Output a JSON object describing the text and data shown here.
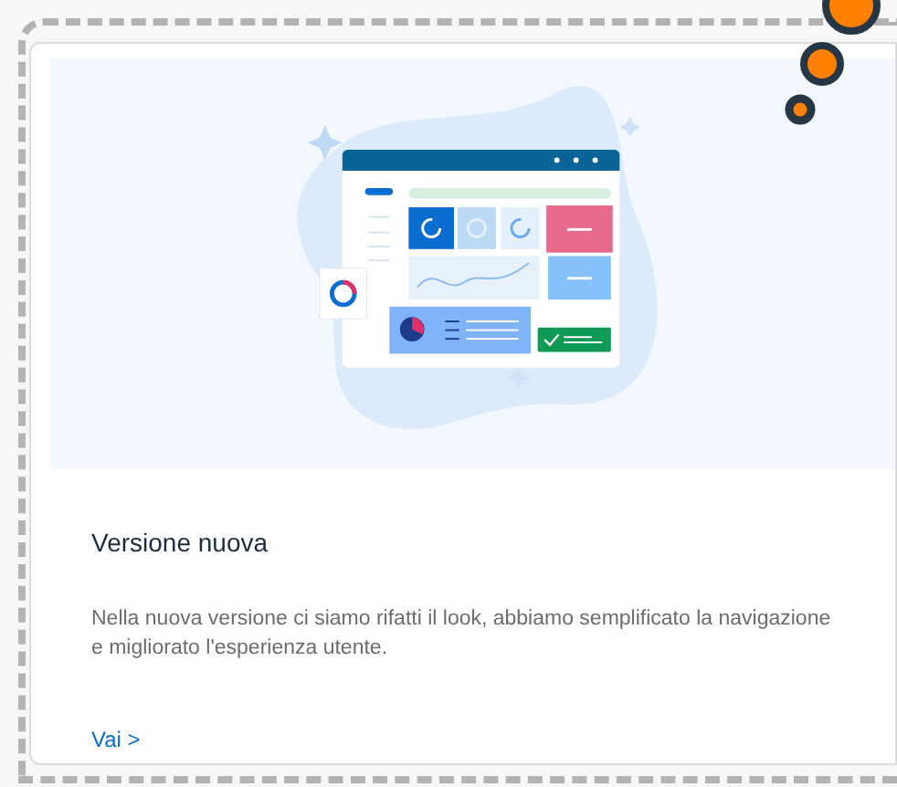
{
  "card": {
    "title": "Versione nuova",
    "description": "Nella nuova versione ci siamo rifatti il look, abbiamo semplificato la navigazione e migliorato l'esperienza utente.",
    "link": "Vai >"
  }
}
